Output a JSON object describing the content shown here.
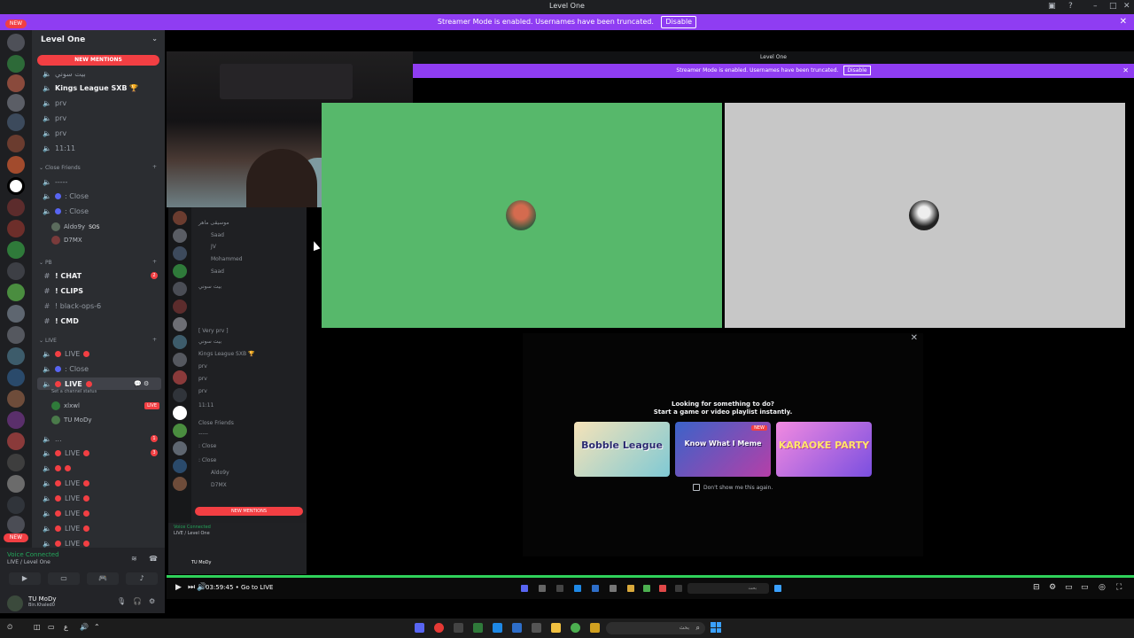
{
  "window": {
    "title": "Level One"
  },
  "banner": {
    "text": "Streamer Mode is enabled. Usernames have been truncated.",
    "disable": "Disable"
  },
  "server_rail": {
    "new_badge": "NEW",
    "new_badge_bottom": "NEW"
  },
  "sidebar": {
    "guild": "Level One",
    "new_mentions": "NEW MENTIONS",
    "channels_top": [
      {
        "icon": "speaker-icon",
        "label": "بيت سوني"
      },
      {
        "icon": "speaker-icon",
        "label": "Kings League SXB 🏆",
        "bold": true
      },
      {
        "icon": "speaker-icon",
        "label": "prv"
      },
      {
        "icon": "speaker-icon",
        "label": "prv"
      },
      {
        "icon": "speaker-icon",
        "label": "prv"
      },
      {
        "icon": "speaker-icon",
        "label": "11:11"
      }
    ],
    "category_close_friends": "Close Friends",
    "close_friends": [
      {
        "label": "-----"
      },
      {
        "label": ": Close"
      },
      {
        "label": ": Close"
      }
    ],
    "members_close": [
      {
        "name": "Aldo9y",
        "tag": "SOS"
      },
      {
        "name": "D7MX"
      }
    ],
    "category_pb": "PB",
    "text_channels": [
      {
        "label": "! CHAT",
        "badge": "2"
      },
      {
        "label": "! CLIPS"
      },
      {
        "label": "! black-ops-6"
      },
      {
        "label": "! CMD"
      }
    ],
    "category_live": "LIVE",
    "live_channels": [
      {
        "label": "LIVE"
      },
      {
        "label": ": Close"
      },
      {
        "label": "LIVE",
        "status": "Set a channel status"
      }
    ],
    "live_members": [
      {
        "name": "xlxwl",
        "live": "LIVE"
      },
      {
        "name": "TU MoDy"
      }
    ],
    "more_channels": [
      {
        "label": "...",
        "badge": "1"
      },
      {
        "label": "LIVE",
        "badge": "3"
      },
      {
        "label": ""
      },
      {
        "label": "LIVE"
      },
      {
        "label": "LIVE"
      },
      {
        "label": "LIVE"
      },
      {
        "label": "LIVE"
      },
      {
        "label": "LIVE"
      }
    ]
  },
  "voice_panel": {
    "status": "Voice Connected",
    "channel": "LIVE / Level One",
    "user_name": "TU MoDy",
    "user_sub": "Bin.Khaled0"
  },
  "nested": {
    "channels": [
      "موسيقى ماهر",
      "Saad",
      "JV",
      "Mohammed",
      "Saad",
      "بيت سوني",
      "[ Very prv ]",
      "بيت سوني",
      "Kings League SXB 🏆",
      "prv",
      "prv",
      "prv",
      "11:11",
      "Close Friends",
      "-----",
      ": Close",
      ": Close",
      "Aldo9y",
      "D7MX"
    ],
    "new_mentions": "NEW MENTIONS",
    "voice_status": "Voice Connected",
    "voice_channel": "LIVE / Level One",
    "user_name": "TU MoDy"
  },
  "stream_window": {
    "title": "Level One",
    "banner": "Streamer Mode is enabled. Usernames have been truncated.",
    "disable": "Disable"
  },
  "activity": {
    "headline_1": "Looking for something to do?",
    "headline_2": "Start a game or video playlist instantly.",
    "cards": [
      {
        "label": "Bobble League",
        "color": "#f3d9b3"
      },
      {
        "label": "Know What I Meme",
        "color": "#3b63c9",
        "tag": "NEW"
      },
      {
        "label": "KARAOKE PARTY",
        "color": "#e87fd8"
      }
    ],
    "dont_show": "Don't show me this again."
  },
  "player": {
    "time": "03:59:45",
    "chapter": "Go to LIVE",
    "progress_pct": 100
  },
  "taskbar": {
    "search_placeholder": "بحث",
    "lang": "ع",
    "time": "",
    "date": ""
  },
  "colors": {
    "accent_purple": "#8f3df2",
    "danger_red": "#f23f43",
    "online_green": "#23a55a",
    "tile_green": "#57b86b",
    "tile_grey": "#c7c7c7"
  }
}
